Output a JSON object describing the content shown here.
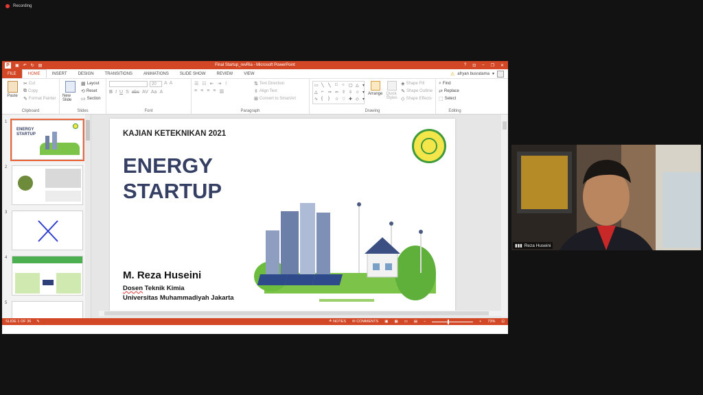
{
  "recording": {
    "label": "Recording"
  },
  "titlebar": {
    "title": "Final Startup_revRia  -  Microsoft PowerPoint",
    "help": "?",
    "minimize": "–",
    "restore": "❐",
    "close": "✕"
  },
  "tabs": [
    "FILE",
    "HOME",
    "INSERT",
    "DESIGN",
    "TRANSITIONS",
    "ANIMATIONS",
    "SLIDE SHOW",
    "REVIEW",
    "VIEW"
  ],
  "active_tab": "HOME",
  "user": {
    "name": "afryan busratama"
  },
  "ribbon": {
    "clipboard": {
      "label": "Clipboard",
      "paste": "Paste",
      "cut": "Cut",
      "copy": "Copy",
      "format_painter": "Format Painter"
    },
    "slides": {
      "label": "Slides",
      "new_slide": "New Slide",
      "layout": "Layout",
      "reset": "Reset",
      "section": "Section"
    },
    "font": {
      "label": "Font",
      "size": "20"
    },
    "paragraph": {
      "label": "Paragraph",
      "text_direction": "Text Direction",
      "align_text": "Align Text",
      "convert_smartart": "Convert to SmartArt"
    },
    "drawing": {
      "label": "Drawing",
      "arrange": "Arrange",
      "quick_styles": "Quick Styles",
      "shape_fill": "Shape Fill",
      "shape_outline": "Shape Outline",
      "shape_effects": "Shape Effects"
    },
    "editing": {
      "label": "Editing",
      "find": "Find",
      "replace": "Replace",
      "select": "Select"
    }
  },
  "thumbnails": [
    {
      "num": "1",
      "title_line1": "ENERGY",
      "title_line2": "STARTUP"
    },
    {
      "num": "2"
    },
    {
      "num": "3"
    },
    {
      "num": "4"
    },
    {
      "num": "5"
    }
  ],
  "slide": {
    "heading": "KAJIAN KETEKNIKAN 2021",
    "title_line1": "ENERGY",
    "title_line2": "STARTUP",
    "presenter": "M. Reza Huseini",
    "role_word1": "Dosen",
    "role_rest": " Teknik Kimia",
    "university": "Universitas Muhammadiyah Jakarta"
  },
  "status": {
    "slide_info": "SLIDE 1 OF 36",
    "notes": "NOTES",
    "comments": "COMMENTS",
    "zoom": "73%",
    "zoom_level_fraction": 0.38
  },
  "video": {
    "participant_name": "Reza Huseini"
  },
  "colors": {
    "ppt_accent": "#d24726",
    "title_navy": "#353f64",
    "seal_green": "#3e9a3a"
  }
}
